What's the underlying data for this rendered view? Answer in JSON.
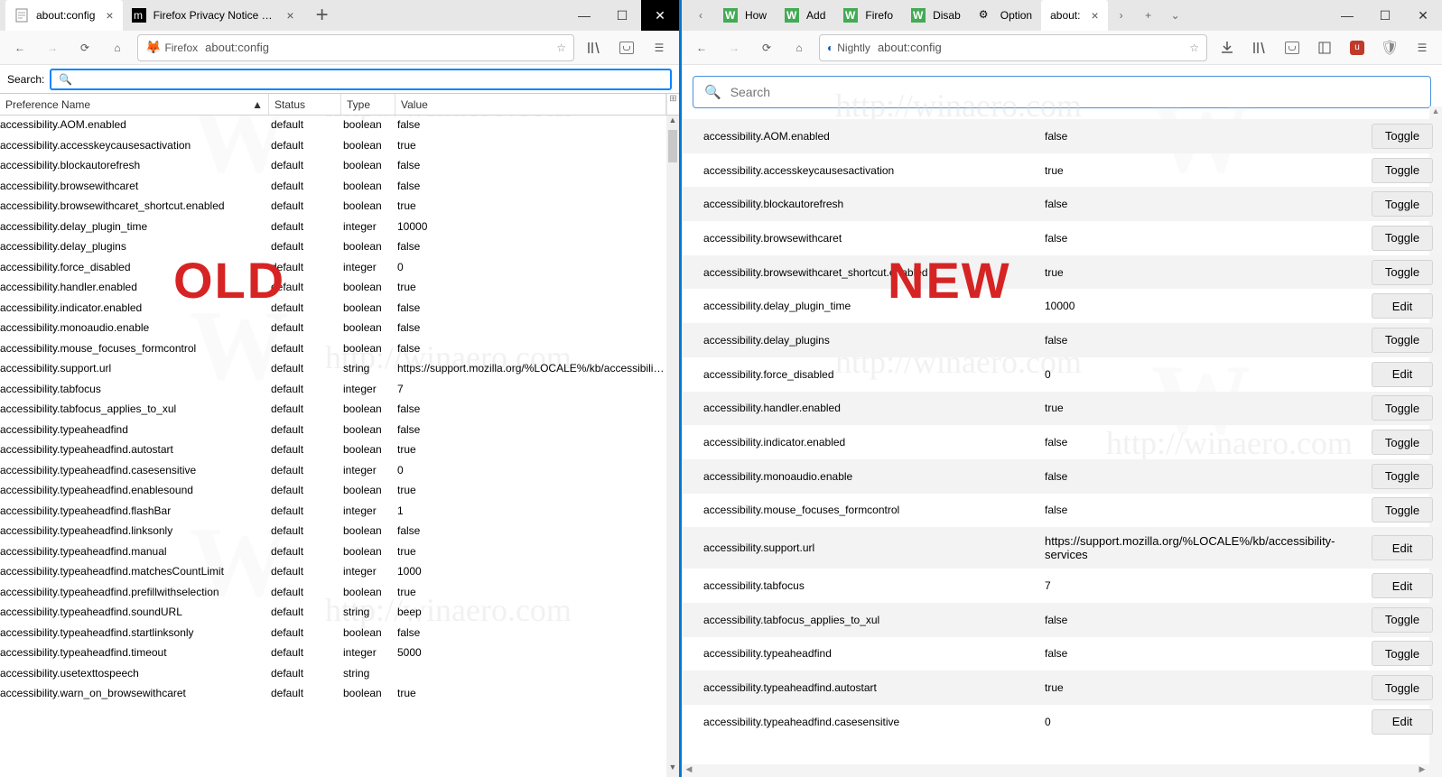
{
  "left": {
    "tabs": [
      {
        "title": "about:config",
        "active": true,
        "fav": "page"
      },
      {
        "title": "Firefox Privacy Notice — Mozi",
        "active": false,
        "fav": "moz"
      }
    ],
    "identity_label": "Firefox",
    "url": "about:config",
    "search_label": "Search:",
    "columns": {
      "name": "Preference Name",
      "status": "Status",
      "type": "Type",
      "value": "Value",
      "sort": "▲"
    },
    "rows": [
      {
        "n": "accessibility.AOM.enabled",
        "s": "default",
        "t": "boolean",
        "v": "false"
      },
      {
        "n": "accessibility.accesskeycausesactivation",
        "s": "default",
        "t": "boolean",
        "v": "true"
      },
      {
        "n": "accessibility.blockautorefresh",
        "s": "default",
        "t": "boolean",
        "v": "false"
      },
      {
        "n": "accessibility.browsewithcaret",
        "s": "default",
        "t": "boolean",
        "v": "false"
      },
      {
        "n": "accessibility.browsewithcaret_shortcut.enabled",
        "s": "default",
        "t": "boolean",
        "v": "true"
      },
      {
        "n": "accessibility.delay_plugin_time",
        "s": "default",
        "t": "integer",
        "v": "10000"
      },
      {
        "n": "accessibility.delay_plugins",
        "s": "default",
        "t": "boolean",
        "v": "false"
      },
      {
        "n": "accessibility.force_disabled",
        "s": "default",
        "t": "integer",
        "v": "0"
      },
      {
        "n": "accessibility.handler.enabled",
        "s": "default",
        "t": "boolean",
        "v": "true"
      },
      {
        "n": "accessibility.indicator.enabled",
        "s": "default",
        "t": "boolean",
        "v": "false"
      },
      {
        "n": "accessibility.monoaudio.enable",
        "s": "default",
        "t": "boolean",
        "v": "false"
      },
      {
        "n": "accessibility.mouse_focuses_formcontrol",
        "s": "default",
        "t": "boolean",
        "v": "false"
      },
      {
        "n": "accessibility.support.url",
        "s": "default",
        "t": "string",
        "v": "https://support.mozilla.org/%LOCALE%/kb/accessibility..."
      },
      {
        "n": "accessibility.tabfocus",
        "s": "default",
        "t": "integer",
        "v": "7"
      },
      {
        "n": "accessibility.tabfocus_applies_to_xul",
        "s": "default",
        "t": "boolean",
        "v": "false"
      },
      {
        "n": "accessibility.typeaheadfind",
        "s": "default",
        "t": "boolean",
        "v": "false"
      },
      {
        "n": "accessibility.typeaheadfind.autostart",
        "s": "default",
        "t": "boolean",
        "v": "true"
      },
      {
        "n": "accessibility.typeaheadfind.casesensitive",
        "s": "default",
        "t": "integer",
        "v": "0"
      },
      {
        "n": "accessibility.typeaheadfind.enablesound",
        "s": "default",
        "t": "boolean",
        "v": "true"
      },
      {
        "n": "accessibility.typeaheadfind.flashBar",
        "s": "default",
        "t": "integer",
        "v": "1"
      },
      {
        "n": "accessibility.typeaheadfind.linksonly",
        "s": "default",
        "t": "boolean",
        "v": "false"
      },
      {
        "n": "accessibility.typeaheadfind.manual",
        "s": "default",
        "t": "boolean",
        "v": "true"
      },
      {
        "n": "accessibility.typeaheadfind.matchesCountLimit",
        "s": "default",
        "t": "integer",
        "v": "1000"
      },
      {
        "n": "accessibility.typeaheadfind.prefillwithselection",
        "s": "default",
        "t": "boolean",
        "v": "true"
      },
      {
        "n": "accessibility.typeaheadfind.soundURL",
        "s": "default",
        "t": "string",
        "v": "beep"
      },
      {
        "n": "accessibility.typeaheadfind.startlinksonly",
        "s": "default",
        "t": "boolean",
        "v": "false"
      },
      {
        "n": "accessibility.typeaheadfind.timeout",
        "s": "default",
        "t": "integer",
        "v": "5000"
      },
      {
        "n": "accessibility.usetexttospeech",
        "s": "default",
        "t": "string",
        "v": ""
      },
      {
        "n": "accessibility.warn_on_browsewithcaret",
        "s": "default",
        "t": "boolean",
        "v": "true"
      }
    ],
    "overlay": "OLD"
  },
  "right": {
    "tabs": [
      {
        "title": "How",
        "fav": "W"
      },
      {
        "title": "Add",
        "fav": "W"
      },
      {
        "title": "Firefo",
        "fav": "W"
      },
      {
        "title": "Disab",
        "fav": "W"
      },
      {
        "title": "Option",
        "fav": "gear"
      },
      {
        "title": "about:",
        "active": true,
        "fav": "page"
      }
    ],
    "identity_label": "Nightly",
    "url": "about:config",
    "search_placeholder": "Search",
    "rows": [
      {
        "n": "accessibility.AOM.enabled",
        "v": "false",
        "b": "Toggle"
      },
      {
        "n": "accessibility.accesskeycausesactivation",
        "v": "true",
        "b": "Toggle"
      },
      {
        "n": "accessibility.blockautorefresh",
        "v": "false",
        "b": "Toggle"
      },
      {
        "n": "accessibility.browsewithcaret",
        "v": "false",
        "b": "Toggle"
      },
      {
        "n": "accessibility.browsewithcaret_shortcut.enabled",
        "v": "true",
        "b": "Toggle"
      },
      {
        "n": "accessibility.delay_plugin_time",
        "v": "10000",
        "b": "Edit"
      },
      {
        "n": "accessibility.delay_plugins",
        "v": "false",
        "b": "Toggle"
      },
      {
        "n": "accessibility.force_disabled",
        "v": "0",
        "b": "Edit"
      },
      {
        "n": "accessibility.handler.enabled",
        "v": "true",
        "b": "Toggle"
      },
      {
        "n": "accessibility.indicator.enabled",
        "v": "false",
        "b": "Toggle"
      },
      {
        "n": "accessibility.monoaudio.enable",
        "v": "false",
        "b": "Toggle"
      },
      {
        "n": "accessibility.mouse_focuses_formcontrol",
        "v": "false",
        "b": "Toggle"
      },
      {
        "n": "accessibility.support.url",
        "v": "https://support.mozilla.org/%LOCALE%/kb/accessibility-services",
        "b": "Edit",
        "wrap": true
      },
      {
        "n": "accessibility.tabfocus",
        "v": "7",
        "b": "Edit"
      },
      {
        "n": "accessibility.tabfocus_applies_to_xul",
        "v": "false",
        "b": "Toggle"
      },
      {
        "n": "accessibility.typeaheadfind",
        "v": "false",
        "b": "Toggle"
      },
      {
        "n": "accessibility.typeaheadfind.autostart",
        "v": "true",
        "b": "Toggle"
      },
      {
        "n": "accessibility.typeaheadfind.casesensitive",
        "v": "0",
        "b": "Edit"
      }
    ],
    "overlay": "NEW"
  },
  "wm": {
    "url": "http://winaero.com",
    "brand": "W"
  }
}
